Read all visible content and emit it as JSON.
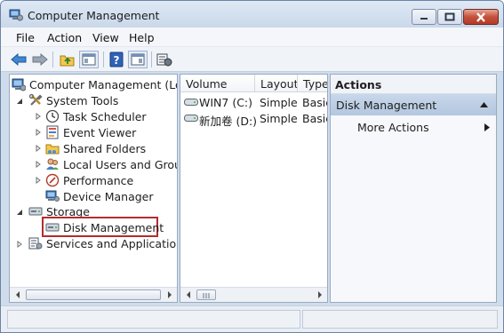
{
  "window": {
    "title": "Computer Management"
  },
  "menu": [
    "File",
    "Action",
    "View",
    "Help"
  ],
  "tree": {
    "root": "Computer Management (Local",
    "system_tools": "System Tools",
    "system_tools_children": [
      "Task Scheduler",
      "Event Viewer",
      "Shared Folders",
      "Local Users and Groups",
      "Performance",
      "Device Manager"
    ],
    "storage": "Storage",
    "disk_management": "Disk Management",
    "services": "Services and Applications"
  },
  "volumes": {
    "columns": [
      "Volume",
      "Layout",
      "Type"
    ],
    "rows": [
      {
        "volume": "WIN7 (C:)",
        "layout": "Simple",
        "type": "Basic"
      },
      {
        "volume": "新加卷 (D:)",
        "layout": "Simple",
        "type": "Basic"
      }
    ]
  },
  "actions": {
    "header": "Actions",
    "section": "Disk Management",
    "more": "More Actions"
  },
  "colors": {
    "selection_outline": "#b32d2d",
    "section_bg": "#c8d7ea"
  }
}
